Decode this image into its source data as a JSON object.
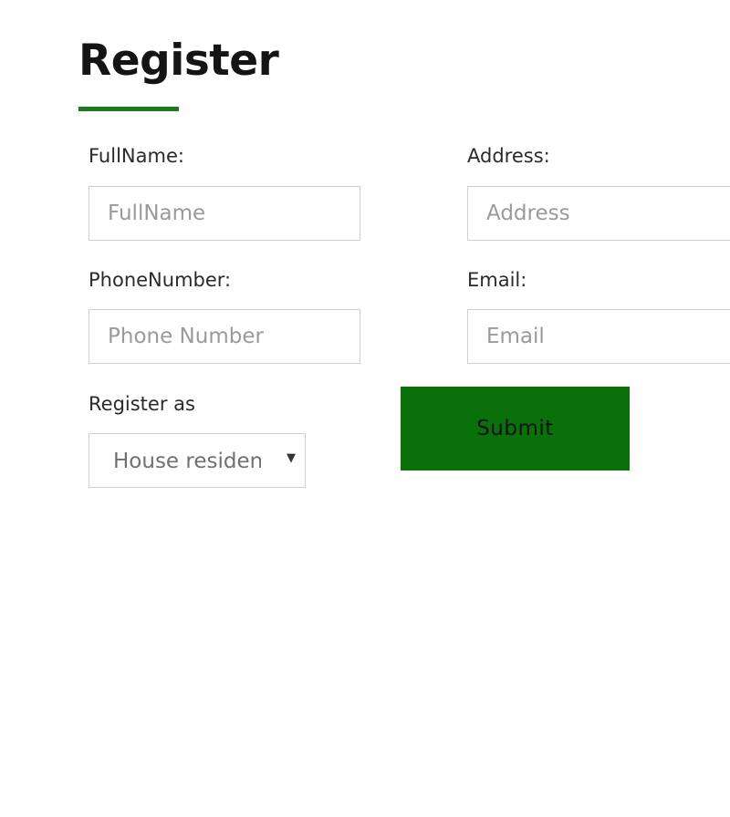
{
  "form": {
    "title": "Register",
    "fields": {
      "fullname": {
        "label": "FullName:",
        "placeholder": "FullName",
        "value": ""
      },
      "address": {
        "label": "Address:",
        "placeholder": "Address",
        "value": ""
      },
      "phone": {
        "label": "PhoneNumber:",
        "placeholder": "Phone Number",
        "value": ""
      },
      "email": {
        "label": "Email:",
        "placeholder": "Email",
        "value": ""
      }
    },
    "register_as": {
      "label": "Register as",
      "selected": "House resident"
    },
    "submit_label": "Submit"
  },
  "colors": {
    "accent": "#1e7a1e",
    "button_background": "#0a700a",
    "input_border": "#cfcfcf"
  },
  "icons": {
    "select_caret": "chevron-down-icon"
  }
}
